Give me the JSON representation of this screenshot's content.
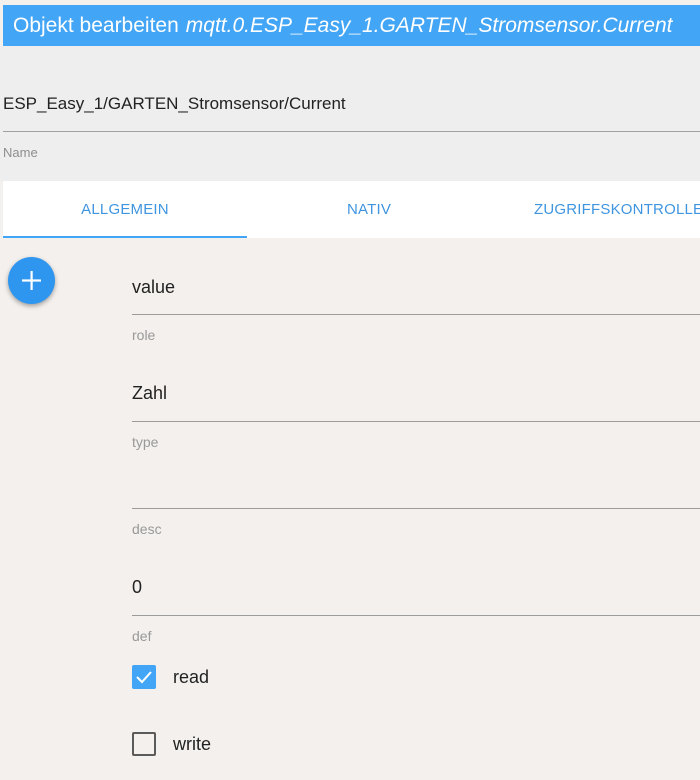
{
  "dialog": {
    "title_prefix": "Objekt bearbeiten",
    "object_id": "mqtt.0.ESP_Easy_1.GARTEN_Stromsensor.Current",
    "accent_color": "#42a5f5"
  },
  "name_field": {
    "value": "ESP_Easy_1/GARTEN_Stromsensor/Current",
    "label": "Name"
  },
  "tabs": [
    {
      "label": "ALLGEMEIN",
      "active": true
    },
    {
      "label": "NATIV",
      "active": false
    },
    {
      "label": "ZUGRIFFSKONTROLLE",
      "active": false
    }
  ],
  "fab": {
    "icon": "plus-icon"
  },
  "fields": {
    "role": {
      "value": "value",
      "label": "role"
    },
    "type": {
      "value": "Zahl",
      "label": "type"
    },
    "desc": {
      "value": "",
      "label": "desc"
    },
    "def": {
      "value": "0",
      "label": "def"
    }
  },
  "checkboxes": {
    "read": {
      "label": "read",
      "checked": true
    },
    "write": {
      "label": "write",
      "checked": false
    }
  }
}
